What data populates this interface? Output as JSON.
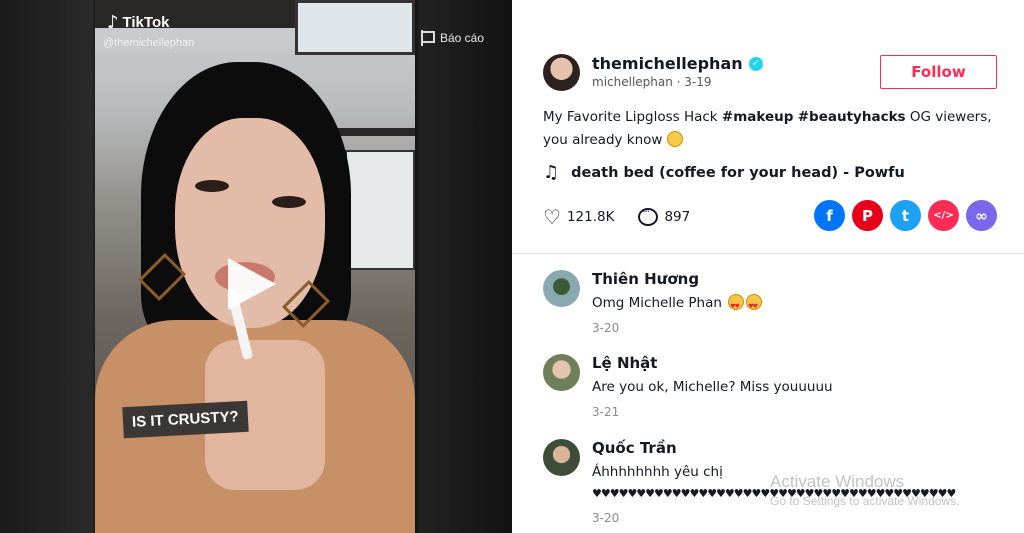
{
  "video": {
    "brand": "TikTok",
    "handle": "@themichellephan",
    "report_label": "Báo cáo",
    "caption_sticker": "IS IT CRUSTY?"
  },
  "author": {
    "username": "themichellephan",
    "sub_handle": "michellephan · 3-19",
    "follow_label": "Follow"
  },
  "description": {
    "part1": "My Favorite Lipgloss Hack ",
    "tag1": "#makeup",
    "tag2": "#beautyhacks",
    "part2": " OG viewers, you already know "
  },
  "music": {
    "icon": "music-note-icon",
    "title": "death bed (coffee for your head) - Powfu"
  },
  "stats": {
    "likes": "121.8K",
    "comments": "897"
  },
  "share": [
    {
      "name": "facebook",
      "glyph": "f",
      "color": "#0075fa"
    },
    {
      "name": "pinterest",
      "glyph": "P",
      "color": "#e60019"
    },
    {
      "name": "twitter",
      "glyph": "t",
      "color": "#1da1f2"
    },
    {
      "name": "embed",
      "glyph": "</>",
      "color": "#fe2c55"
    },
    {
      "name": "link",
      "glyph": "∞",
      "color": "#7b67ee"
    }
  ],
  "comments": [
    {
      "name": "Thiên Hương",
      "text": "Omg Michelle Phan",
      "date": "3-20"
    },
    {
      "name": "Lệ Nhật",
      "text": "Are you ok, Michelle? Miss youuuuu",
      "date": "3-21"
    },
    {
      "name": "Quốc Trần",
      "text": "Áhhhhhhhh yêu chị",
      "text2": "♥♥♥♥♥♥♥♥♥♥♥♥♥♥♥♥♥♥♥♥♥♥♥♥♥♥♥♥♥♥♥♥♥♥♥♥♥♥♥♥♥",
      "date": "3-20"
    }
  ],
  "watermark": {
    "line1": "Activate Windows",
    "line2": "Go to Settings to activate Windows."
  },
  "colors": {
    "accent": "#fe2c55",
    "verified": "#20d5ec"
  }
}
